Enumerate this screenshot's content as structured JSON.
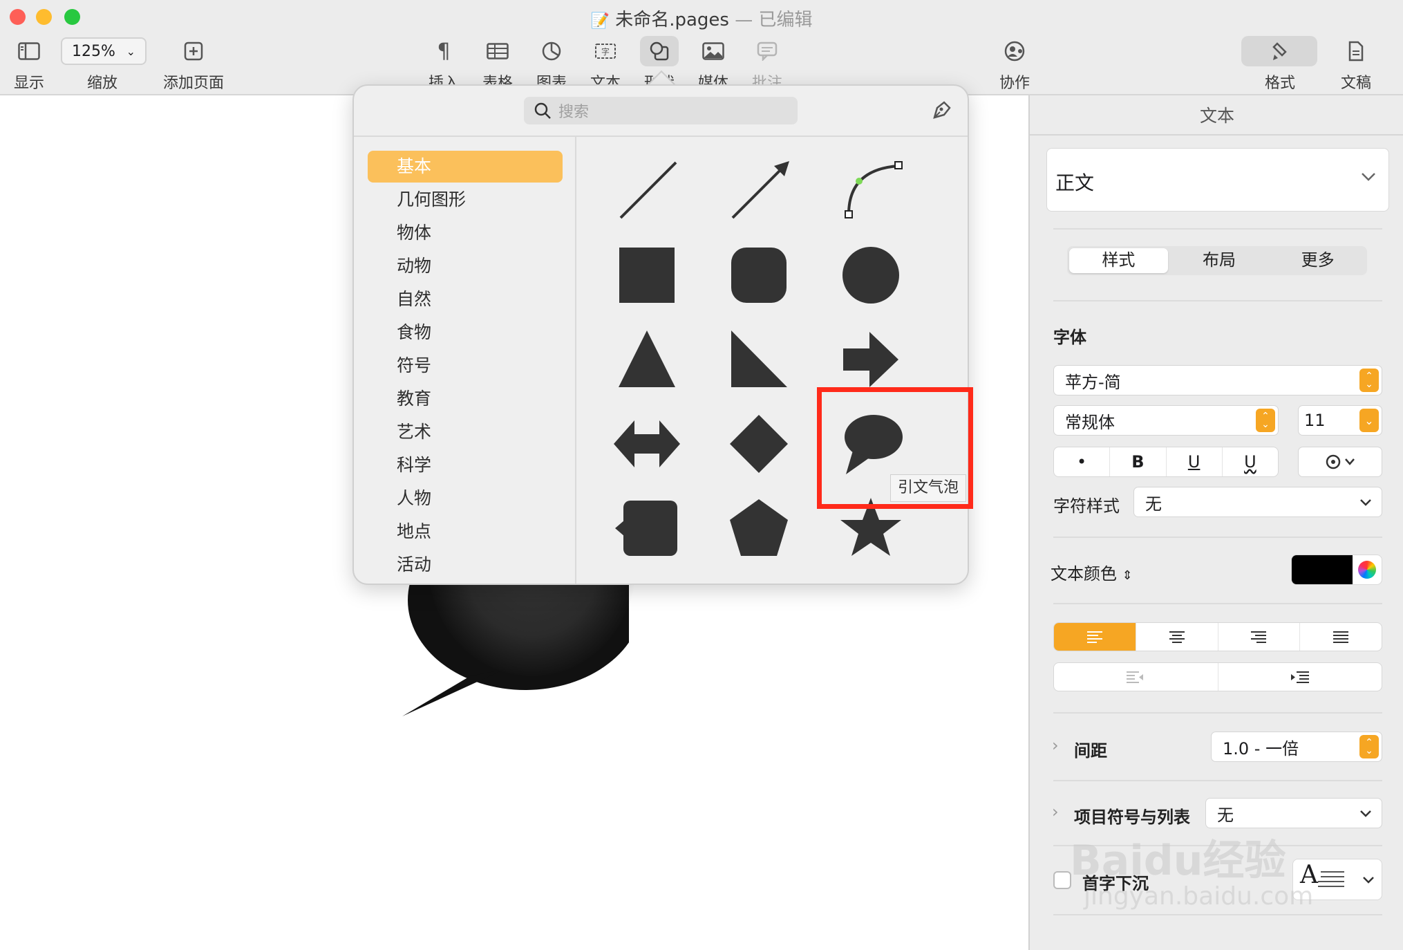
{
  "window": {
    "title": "未命名.pages",
    "separator": "—",
    "status": "已编辑"
  },
  "toolbar": {
    "display": "显示",
    "zoom_value": "125%",
    "zoom": "缩放",
    "add_page": "添加页面",
    "insert": "插入",
    "table": "表格",
    "chart": "图表",
    "text": "文本",
    "shape": "形状",
    "media": "媒体",
    "comment": "批注",
    "collaborate": "协作",
    "format": "格式",
    "document": "文稿"
  },
  "shapes_popover": {
    "search_placeholder": "搜索",
    "categories": [
      "基本",
      "几何图形",
      "物体",
      "动物",
      "自然",
      "食物",
      "符号",
      "教育",
      "艺术",
      "科学",
      "人物",
      "地点",
      "活动"
    ],
    "selected_category": "基本",
    "shapes": [
      "line",
      "arrow-line",
      "curve",
      "square",
      "rounded-square",
      "circle",
      "triangle",
      "right-triangle",
      "arrow",
      "double-arrow",
      "diamond",
      "quote-bubble",
      "callout-square",
      "pentagon",
      "star"
    ],
    "tooltip": "引文气泡"
  },
  "inspector": {
    "title": "文本",
    "paragraph_style": "正文",
    "tabs": [
      "样式",
      "布局",
      "更多"
    ],
    "font_section": "字体",
    "font_family": "苹方-简",
    "font_weight": "常规体",
    "font_size": "11",
    "style_buttons": [
      "•",
      "B",
      "U",
      "U"
    ],
    "char_style_label": "字符样式",
    "char_style_value": "无",
    "text_color_label": "文本颜色",
    "text_color": "#000000",
    "spacing_label": "间距",
    "spacing_value": "1.0 - 一倍",
    "bullets_label": "项目符号与列表",
    "bullets_value": "无",
    "dropcap_label": "首字下沉",
    "dropcap_glyph": "A"
  },
  "watermark": {
    "main": "Baidu经验",
    "sub": "jingyan.baidu.com"
  },
  "colors": {
    "accent": "#f6a623",
    "category_selected": "#fbc05b",
    "highlight": "#ff2a1a",
    "shape_fill": "#333333"
  }
}
